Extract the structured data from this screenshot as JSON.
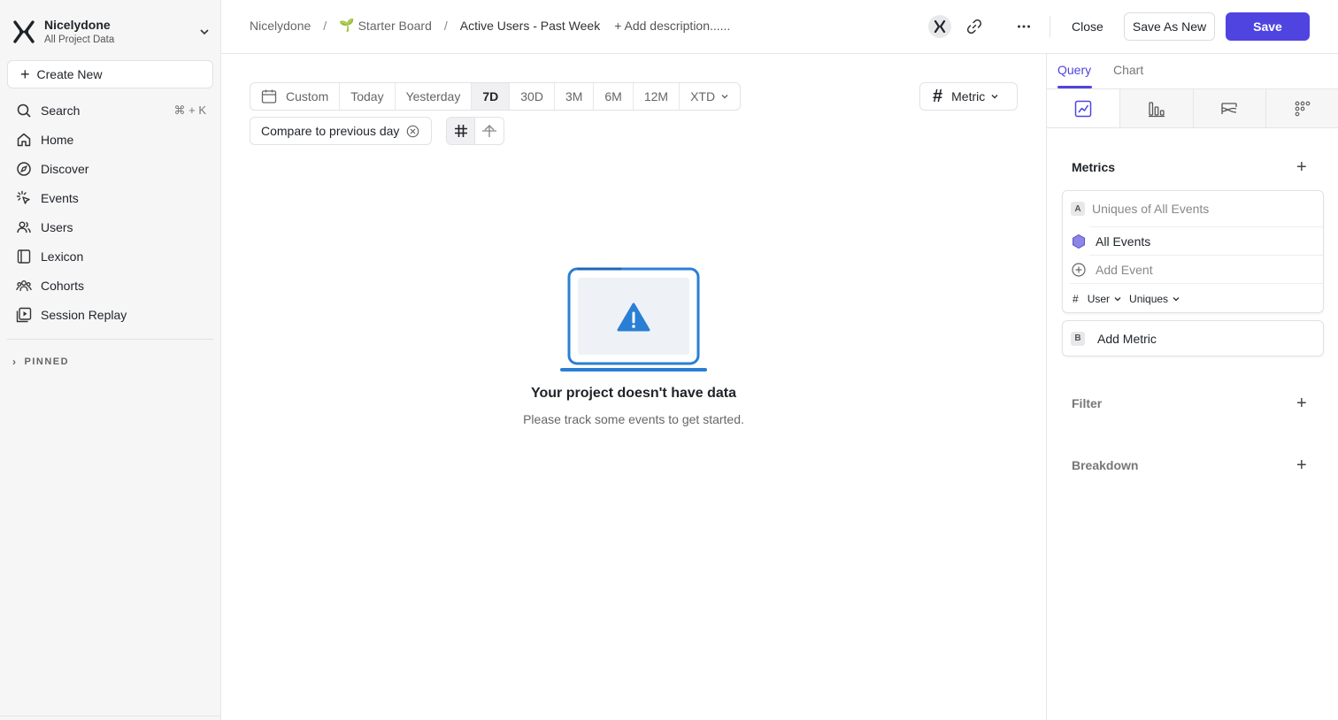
{
  "project": {
    "name": "Nicelydone",
    "subtitle": "All Project Data"
  },
  "sidebar": {
    "create_label": "Create New",
    "search": {
      "label": "Search",
      "shortcut": "⌘ + K"
    },
    "items": [
      {
        "label": "Home",
        "icon": "home-icon"
      },
      {
        "label": "Discover",
        "icon": "compass-icon"
      },
      {
        "label": "Events",
        "icon": "cursor-click-icon"
      },
      {
        "label": "Users",
        "icon": "users-icon"
      },
      {
        "label": "Lexicon",
        "icon": "book-icon"
      },
      {
        "label": "Cohorts",
        "icon": "cohorts-icon"
      },
      {
        "label": "Session Replay",
        "icon": "play-square-icon"
      }
    ],
    "pinned_label": "PINNED"
  },
  "breadcrumb": {
    "root": "Nicelydone",
    "board": "Starter Board",
    "report": "Active Users - Past Week",
    "description_placeholder": "+ Add description......"
  },
  "toolbar": {
    "close_label": "Close",
    "save_as_new_label": "Save As New",
    "save_label": "Save"
  },
  "date_range": {
    "custom_label": "Custom",
    "options": [
      "Today",
      "Yesterday",
      "7D",
      "30D",
      "3M",
      "6M",
      "12M",
      "XTD"
    ],
    "selected": "7D"
  },
  "metric_selector": {
    "label": "Metric"
  },
  "compare": {
    "label": "Compare to previous day"
  },
  "empty_state": {
    "title": "Your project doesn't have data",
    "subtitle": "Please track some events to get started."
  },
  "panel": {
    "tabs": [
      "Query",
      "Chart"
    ],
    "active_tab": "Query",
    "metrics_title": "Metrics",
    "metric_a": {
      "badge": "A",
      "title": "Uniques of All Events",
      "event": "All Events",
      "add_event": "Add Event",
      "aggregation": {
        "entity": "User",
        "measure": "Uniques"
      }
    },
    "add_metric": {
      "badge": "B",
      "label": "Add Metric"
    },
    "filter_title": "Filter",
    "breakdown_title": "Breakdown"
  },
  "colors": {
    "accent": "#4f44e0",
    "illustration": "#2a7fd4",
    "event_hex": "#8c86e6"
  }
}
